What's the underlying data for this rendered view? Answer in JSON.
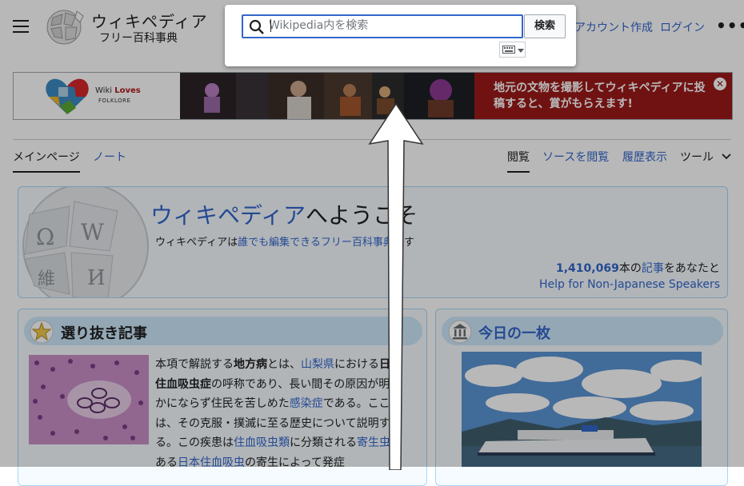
{
  "header": {
    "wordmark": "ウィキペディア",
    "tagline": "フリー百科事典",
    "create_account": "アカウント作成",
    "login": "ログイン",
    "more": "•••"
  },
  "search": {
    "placeholder": "Wikipedia内を検索",
    "button": "検索"
  },
  "banner": {
    "logo_line1_a": "Wiki ",
    "logo_line1_b": "Loves",
    "logo_line2": "FOLKLORE",
    "text": "地元の文物を撮影してウィキペディアに投稿すると、賞がもらえます!",
    "close": "✕"
  },
  "tabs": {
    "main_page": "メインページ",
    "talk": "ノート",
    "read": "閲覧",
    "view_source": "ソースを閲覧",
    "history": "履歴表示",
    "tools": "ツール"
  },
  "welcome": {
    "title_link": "ウィキペディア",
    "title_rest": "へようこそ",
    "sub_before": "ウィキペディアは",
    "sub_link": "誰でも編集できるフリー百科事典",
    "sub_after": "です",
    "count": "1,410,069",
    "count_mid": "本の",
    "count_link": "記事",
    "count_end": "をあなたと",
    "help": "Help for Non-Japanese Speakers"
  },
  "featured": {
    "title": "選り抜き記事",
    "p1": "本項で解説する",
    "l1": "地方病",
    "p2": "とは、",
    "l2": "山梨県",
    "p3": "における",
    "b1": "日本住血吸虫症",
    "p4": "の呼称であり、長い間その原因が明らかにならず住民を苦しめた",
    "l3": "感染症",
    "p5": "である。ここでは、その克服・撲滅に至る歴史について説明する。この疾患は",
    "l4": "住血吸虫類",
    "p6": "に分類される",
    "l5": "寄生虫",
    "p7": "である",
    "l6": "日本住血吸虫",
    "p8": "の寄生によって発症"
  },
  "potd": {
    "title": "今日の一枚"
  }
}
